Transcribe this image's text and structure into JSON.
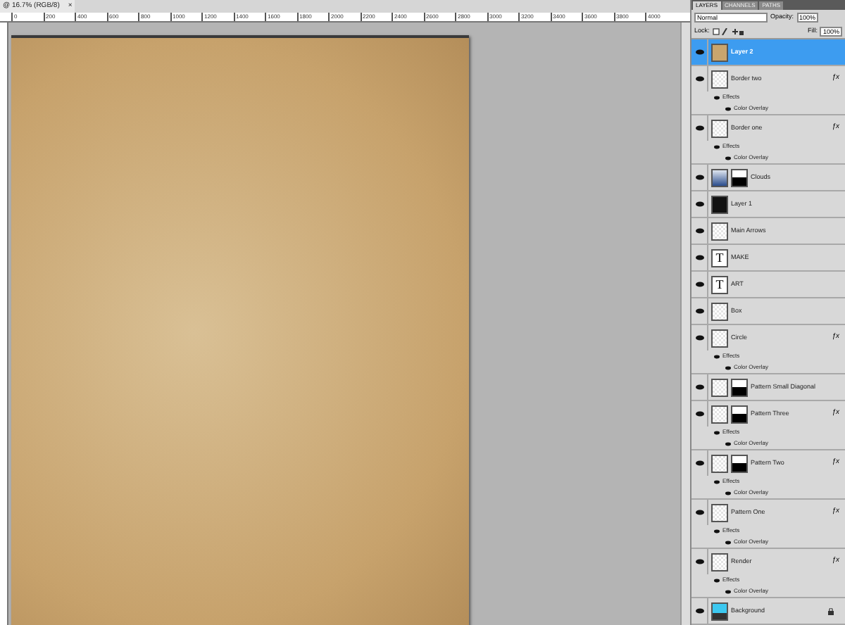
{
  "document_tab": {
    "title": "@ 16.7% (RGB/8)",
    "close": "×"
  },
  "ruler": {
    "ticks": [
      "0",
      "200",
      "400",
      "600",
      "800",
      "1000",
      "1200",
      "1400",
      "1600",
      "1800",
      "2000",
      "2200",
      "2400",
      "2600",
      "2800",
      "3000",
      "3200",
      "3400",
      "3600",
      "3800",
      "4000"
    ]
  },
  "layers_panel": {
    "tabs": [
      {
        "label": "LAYERS",
        "selected": true
      },
      {
        "label": "CHANNELS",
        "selected": false
      },
      {
        "label": "PATHS",
        "selected": false
      }
    ],
    "blend_mode": "Normal",
    "opacity_label": "Opacity:",
    "opacity": "100%",
    "lock_label": "Lock:",
    "fill_label": "Fill:",
    "fill": "100%",
    "layers": [
      {
        "name": "Layer 2",
        "kind": "texture",
        "selected": true,
        "visible": true,
        "mask": false,
        "locked": false
      },
      {
        "name": "Border two",
        "kind": "pattern",
        "selected": false,
        "visible": true,
        "mask": false,
        "locked": false,
        "fx": "ƒx",
        "effects": [
          "Effects",
          "Color Overlay"
        ]
      },
      {
        "name": "Border one",
        "kind": "pattern",
        "selected": false,
        "visible": true,
        "mask": false,
        "locked": false,
        "fx": "ƒx",
        "effects": [
          "Effects",
          "Color Overlay"
        ]
      },
      {
        "name": "Clouds",
        "kind": "clouds",
        "selected": false,
        "visible": true,
        "mask": true,
        "locked": false
      },
      {
        "name": "Layer 1",
        "kind": "dark",
        "selected": false,
        "visible": true,
        "mask": false,
        "locked": false
      },
      {
        "name": "Main Arrows",
        "kind": "pattern",
        "selected": false,
        "visible": true,
        "mask": false,
        "locked": false
      },
      {
        "name": "MAKE",
        "kind": "text",
        "thumb_text": "T",
        "selected": false,
        "visible": true,
        "mask": false,
        "locked": false
      },
      {
        "name": "ART",
        "kind": "text",
        "thumb_text": "T",
        "selected": false,
        "visible": true,
        "mask": false,
        "locked": false
      },
      {
        "name": "Box",
        "kind": "pattern",
        "selected": false,
        "visible": true,
        "mask": false,
        "locked": false
      },
      {
        "name": "Circle",
        "kind": "pattern",
        "selected": false,
        "visible": true,
        "mask": false,
        "locked": false,
        "fx": "ƒx",
        "effects": [
          "Effects",
          "Color Overlay"
        ]
      },
      {
        "name": "Pattern Small Diagonal",
        "kind": "pattern",
        "selected": false,
        "visible": true,
        "mask": true,
        "locked": false
      },
      {
        "name": "Pattern Three",
        "kind": "pattern",
        "selected": false,
        "visible": true,
        "mask": true,
        "locked": false,
        "fx": "ƒx",
        "effects": [
          "Effects",
          "Color Overlay"
        ]
      },
      {
        "name": "Pattern Two",
        "kind": "pattern",
        "selected": false,
        "visible": true,
        "mask": true,
        "locked": false,
        "fx": "ƒx",
        "effects": [
          "Effects",
          "Color Overlay"
        ]
      },
      {
        "name": "Pattern One",
        "kind": "pattern",
        "selected": false,
        "visible": true,
        "mask": false,
        "locked": false,
        "fx": "ƒx",
        "effects": [
          "Effects",
          "Color Overlay"
        ]
      },
      {
        "name": "Render",
        "kind": "pattern",
        "selected": false,
        "visible": true,
        "mask": false,
        "locked": false,
        "fx": "ƒx",
        "effects": [
          "Effects",
          "Color Overlay"
        ]
      },
      {
        "name": "Background",
        "kind": "sky",
        "selected": false,
        "visible": true,
        "mask": false,
        "locked": true
      }
    ]
  }
}
